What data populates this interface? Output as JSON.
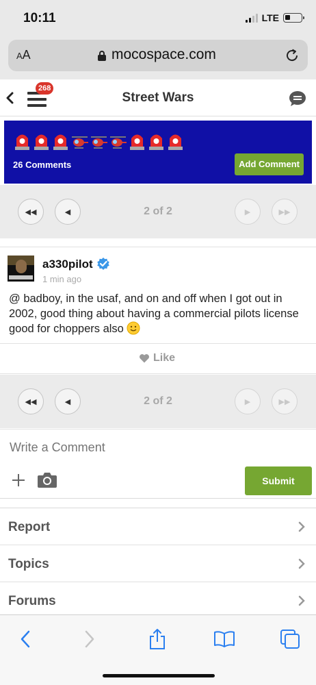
{
  "status_bar": {
    "time": "10:11",
    "network": "LTE"
  },
  "browser": {
    "aa_label": "AA",
    "domain": "mocospace.com"
  },
  "header": {
    "title": "Street Wars",
    "notification_count": "268"
  },
  "banner": {
    "emojis": [
      "police-light",
      "police-light",
      "police-light",
      "helicopter",
      "helicopter",
      "helicopter",
      "police-light",
      "police-light",
      "police-light"
    ],
    "comment_count": "26 Comments",
    "add_comment_label": "Add Comment",
    "background_color": "#1010a6",
    "button_color": "#76a732"
  },
  "pager_top": {
    "label": "2 of 2"
  },
  "comment": {
    "username": "a330pilot",
    "verified": true,
    "time": "1 min ago",
    "body": "@ badboy, in the usaf, and on and off when I got out in 2002, good thing about having a commercial pilots license good for choppers also",
    "emoji": "slightly-smiling-face",
    "like_label": "Like"
  },
  "pager_bottom": {
    "label": "2 of 2"
  },
  "compose": {
    "placeholder": "Write a Comment",
    "submit_label": "Submit"
  },
  "links": [
    {
      "label": "Report"
    },
    {
      "label": "Topics"
    },
    {
      "label": "Forums"
    }
  ],
  "toolbar": {
    "icons": [
      "back-icon",
      "forward-icon",
      "share-icon",
      "bookmarks-icon",
      "tabs-icon"
    ]
  }
}
